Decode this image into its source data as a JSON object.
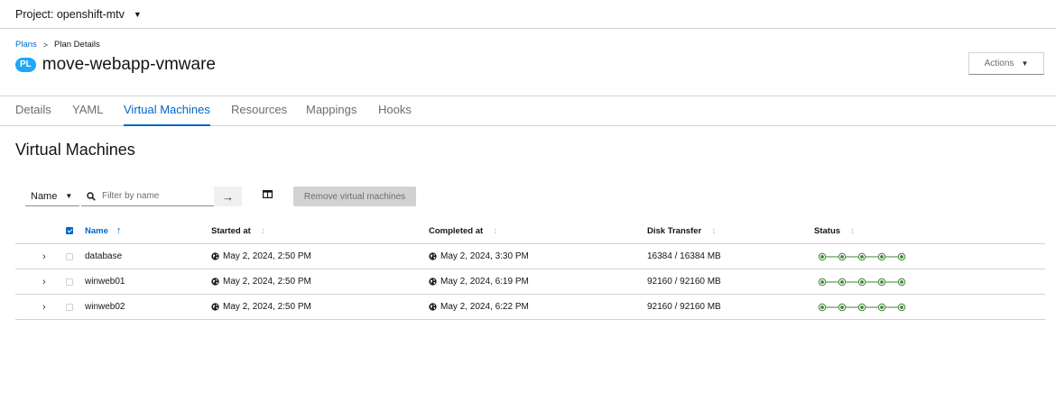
{
  "project_bar": {
    "label": "Project: openshift-mtv"
  },
  "breadcrumb": {
    "parent": "Plans",
    "current": "Plan Details"
  },
  "plan": {
    "badge": "PL",
    "title": "move-webapp-vmware"
  },
  "actions": {
    "label": "Actions"
  },
  "tabs": [
    {
      "label": "Details",
      "active": false
    },
    {
      "label": "YAML",
      "active": false
    },
    {
      "label": "Virtual Machines",
      "active": true
    },
    {
      "label": "Resources",
      "active": false
    },
    {
      "label": "Mappings",
      "active": false
    },
    {
      "label": "Hooks",
      "active": false
    }
  ],
  "section": {
    "title": "Virtual Machines"
  },
  "toolbar": {
    "filter_type": "Name",
    "filter_placeholder": "Filter by name",
    "remove_label": "Remove virtual machines"
  },
  "table": {
    "columns": {
      "name": "Name",
      "started": "Started at",
      "completed": "Completed at",
      "disk": "Disk Transfer",
      "status": "Status"
    },
    "rows": [
      {
        "name": "database",
        "started": "May 2, 2024, 2:50 PM",
        "completed": "May 2, 2024, 3:30 PM",
        "disk": "16384 / 16384 MB"
      },
      {
        "name": "winweb01",
        "started": "May 2, 2024, 2:50 PM",
        "completed": "May 2, 2024, 6:19 PM",
        "disk": "92160 / 92160 MB"
      },
      {
        "name": "winweb02",
        "started": "May 2, 2024, 2:50 PM",
        "completed": "May 2, 2024, 6:22 PM",
        "disk": "92160 / 92160 MB"
      }
    ]
  },
  "colors": {
    "link": "#0066cc",
    "success": "#3e8635",
    "badge": "#1fa7f8"
  }
}
